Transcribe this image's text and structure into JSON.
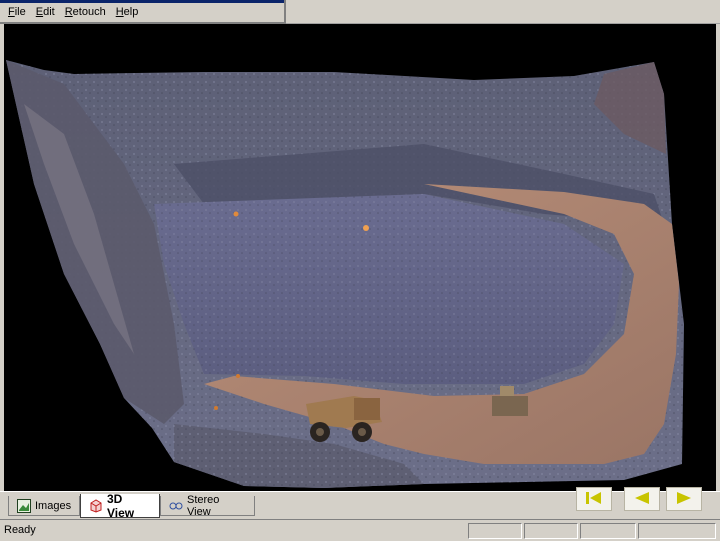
{
  "menu": {
    "items": [
      {
        "label": "File"
      },
      {
        "label": "Edit"
      },
      {
        "label": "Retouch"
      },
      {
        "label": "Help"
      }
    ]
  },
  "viewport": {
    "subject": "3d-textured-mine-pit-model",
    "icon": "3d-model-view"
  },
  "tabs": [
    {
      "label": "Images",
      "icon": "images-icon",
      "active": false
    },
    {
      "label": "3D View",
      "icon": "3d-view-icon",
      "active": true
    },
    {
      "label": "Stereo View",
      "icon": "stereo-view-icon",
      "active": false
    }
  ],
  "nav": {
    "buttons": [
      "first-icon",
      "previous-icon",
      "next-icon"
    ],
    "color": "#c8c400"
  },
  "status": {
    "text": "Ready"
  }
}
